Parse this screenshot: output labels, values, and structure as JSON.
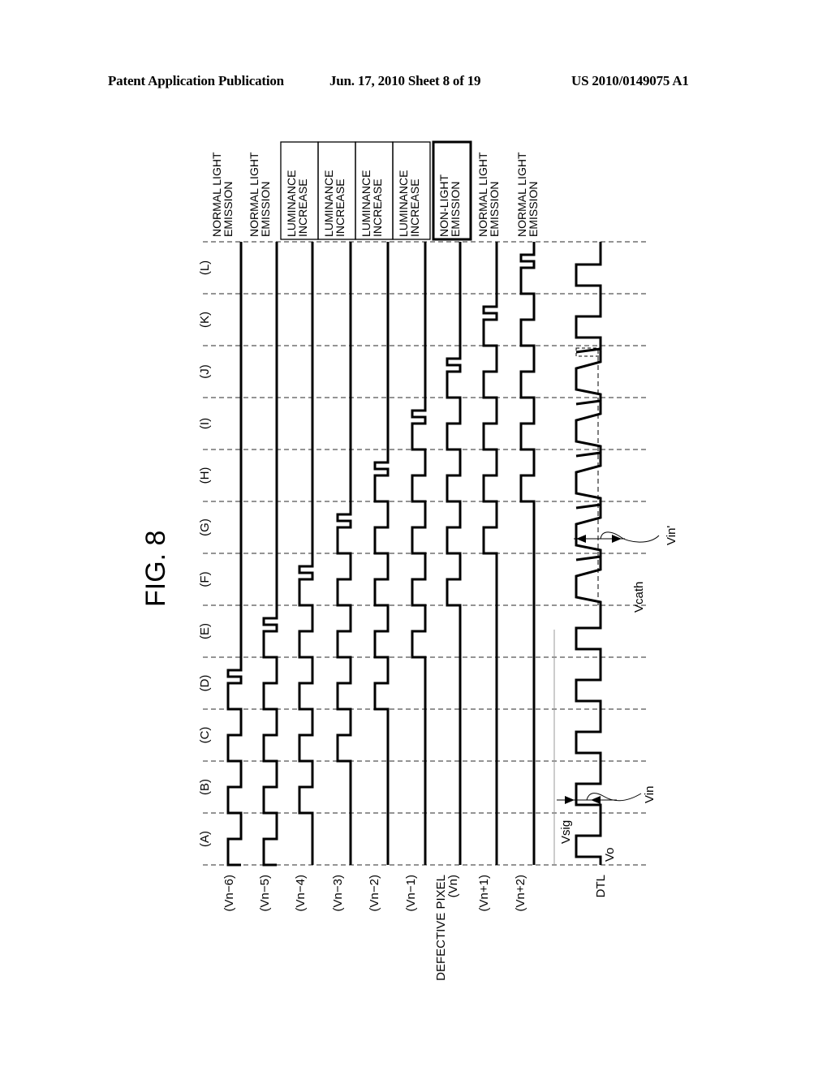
{
  "header": {
    "left": "Patent Application Publication",
    "middle": "Jun. 17, 2010  Sheet 8 of 19",
    "right": "US 2010/0149075 A1"
  },
  "figure": {
    "title": "FIG. 8",
    "orientation": "rotated 90 degrees counter-clockwise",
    "periods": [
      "(A)",
      "(B)",
      "(C)",
      "(D)",
      "(E)",
      "(F)",
      "(G)",
      "(H)",
      "(I)",
      "(J)",
      "(K)",
      "(L)"
    ],
    "signals": [
      {
        "id": "vn-6",
        "label": "(Vn−6)",
        "status": "NORMAL LIGHT\nEMISSION",
        "status_lines": [
          "NORMAL LIGHT",
          "EMISSION"
        ],
        "boxed": false,
        "emphasis": false,
        "pulse_periods": [
          0,
          1,
          2,
          3
        ],
        "extra_pulse_period": 3
      },
      {
        "id": "vn-5",
        "label": "(Vn−5)",
        "status_lines": [
          "NORMAL LIGHT",
          "EMISSION"
        ],
        "boxed": false,
        "emphasis": false,
        "pulse_periods": [
          0,
          1,
          2,
          3,
          4
        ],
        "extra_pulse_period": 4
      },
      {
        "id": "vn-4",
        "label": "(Vn−4)",
        "status_lines": [
          "LUMINANCE",
          "INCREASE"
        ],
        "boxed": true,
        "emphasis": false,
        "pulse_periods": [
          1,
          2,
          3,
          4,
          5
        ],
        "extra_pulse_period": 5
      },
      {
        "id": "vn-3",
        "label": "(Vn−3)",
        "status_lines": [
          "LUMINANCE",
          "INCREASE"
        ],
        "boxed": true,
        "emphasis": false,
        "pulse_periods": [
          2,
          3,
          4,
          5,
          6
        ],
        "extra_pulse_period": 6
      },
      {
        "id": "vn-2",
        "label": "(Vn−2)",
        "status_lines": [
          "LUMINANCE",
          "INCREASE"
        ],
        "boxed": true,
        "emphasis": false,
        "pulse_periods": [
          3,
          4,
          5,
          6,
          7
        ],
        "extra_pulse_period": 7
      },
      {
        "id": "vn-1",
        "label": "(Vn−1)",
        "status_lines": [
          "LUMINANCE",
          "INCREASE"
        ],
        "boxed": true,
        "emphasis": false,
        "pulse_periods": [
          4,
          5,
          6,
          7,
          8
        ],
        "extra_pulse_period": 8
      },
      {
        "id": "vn",
        "label": "(Vn)",
        "label_prefix": "DEFECTIVE PIXEL",
        "status_lines": [
          "NON-LIGHT",
          "EMISSION"
        ],
        "boxed": true,
        "emphasis": true,
        "pulse_periods": [
          5,
          6,
          7,
          8,
          9
        ],
        "extra_pulse_period": 9
      },
      {
        "id": "vn+1",
        "label": "(Vn+1)",
        "status_lines": [
          "NORMAL LIGHT",
          "EMISSION"
        ],
        "boxed": false,
        "emphasis": false,
        "pulse_periods": [
          6,
          7,
          8,
          9,
          10
        ],
        "extra_pulse_period": 10
      },
      {
        "id": "vn+2",
        "label": "(Vn+2)",
        "status_lines": [
          "NORMAL LIGHT",
          "EMISSION"
        ],
        "boxed": false,
        "emphasis": false,
        "pulse_periods": [
          7,
          8,
          9,
          10,
          11
        ],
        "extra_pulse_period": 11
      }
    ],
    "dtl": {
      "label": "DTL",
      "annotations": {
        "vo": "Vo",
        "vsig": "Vsig",
        "vin": "Vin",
        "vcath": "Vcath",
        "vin_prime": "Vin'"
      },
      "sloped_periods": [
        5,
        6,
        7,
        8,
        9
      ]
    }
  }
}
